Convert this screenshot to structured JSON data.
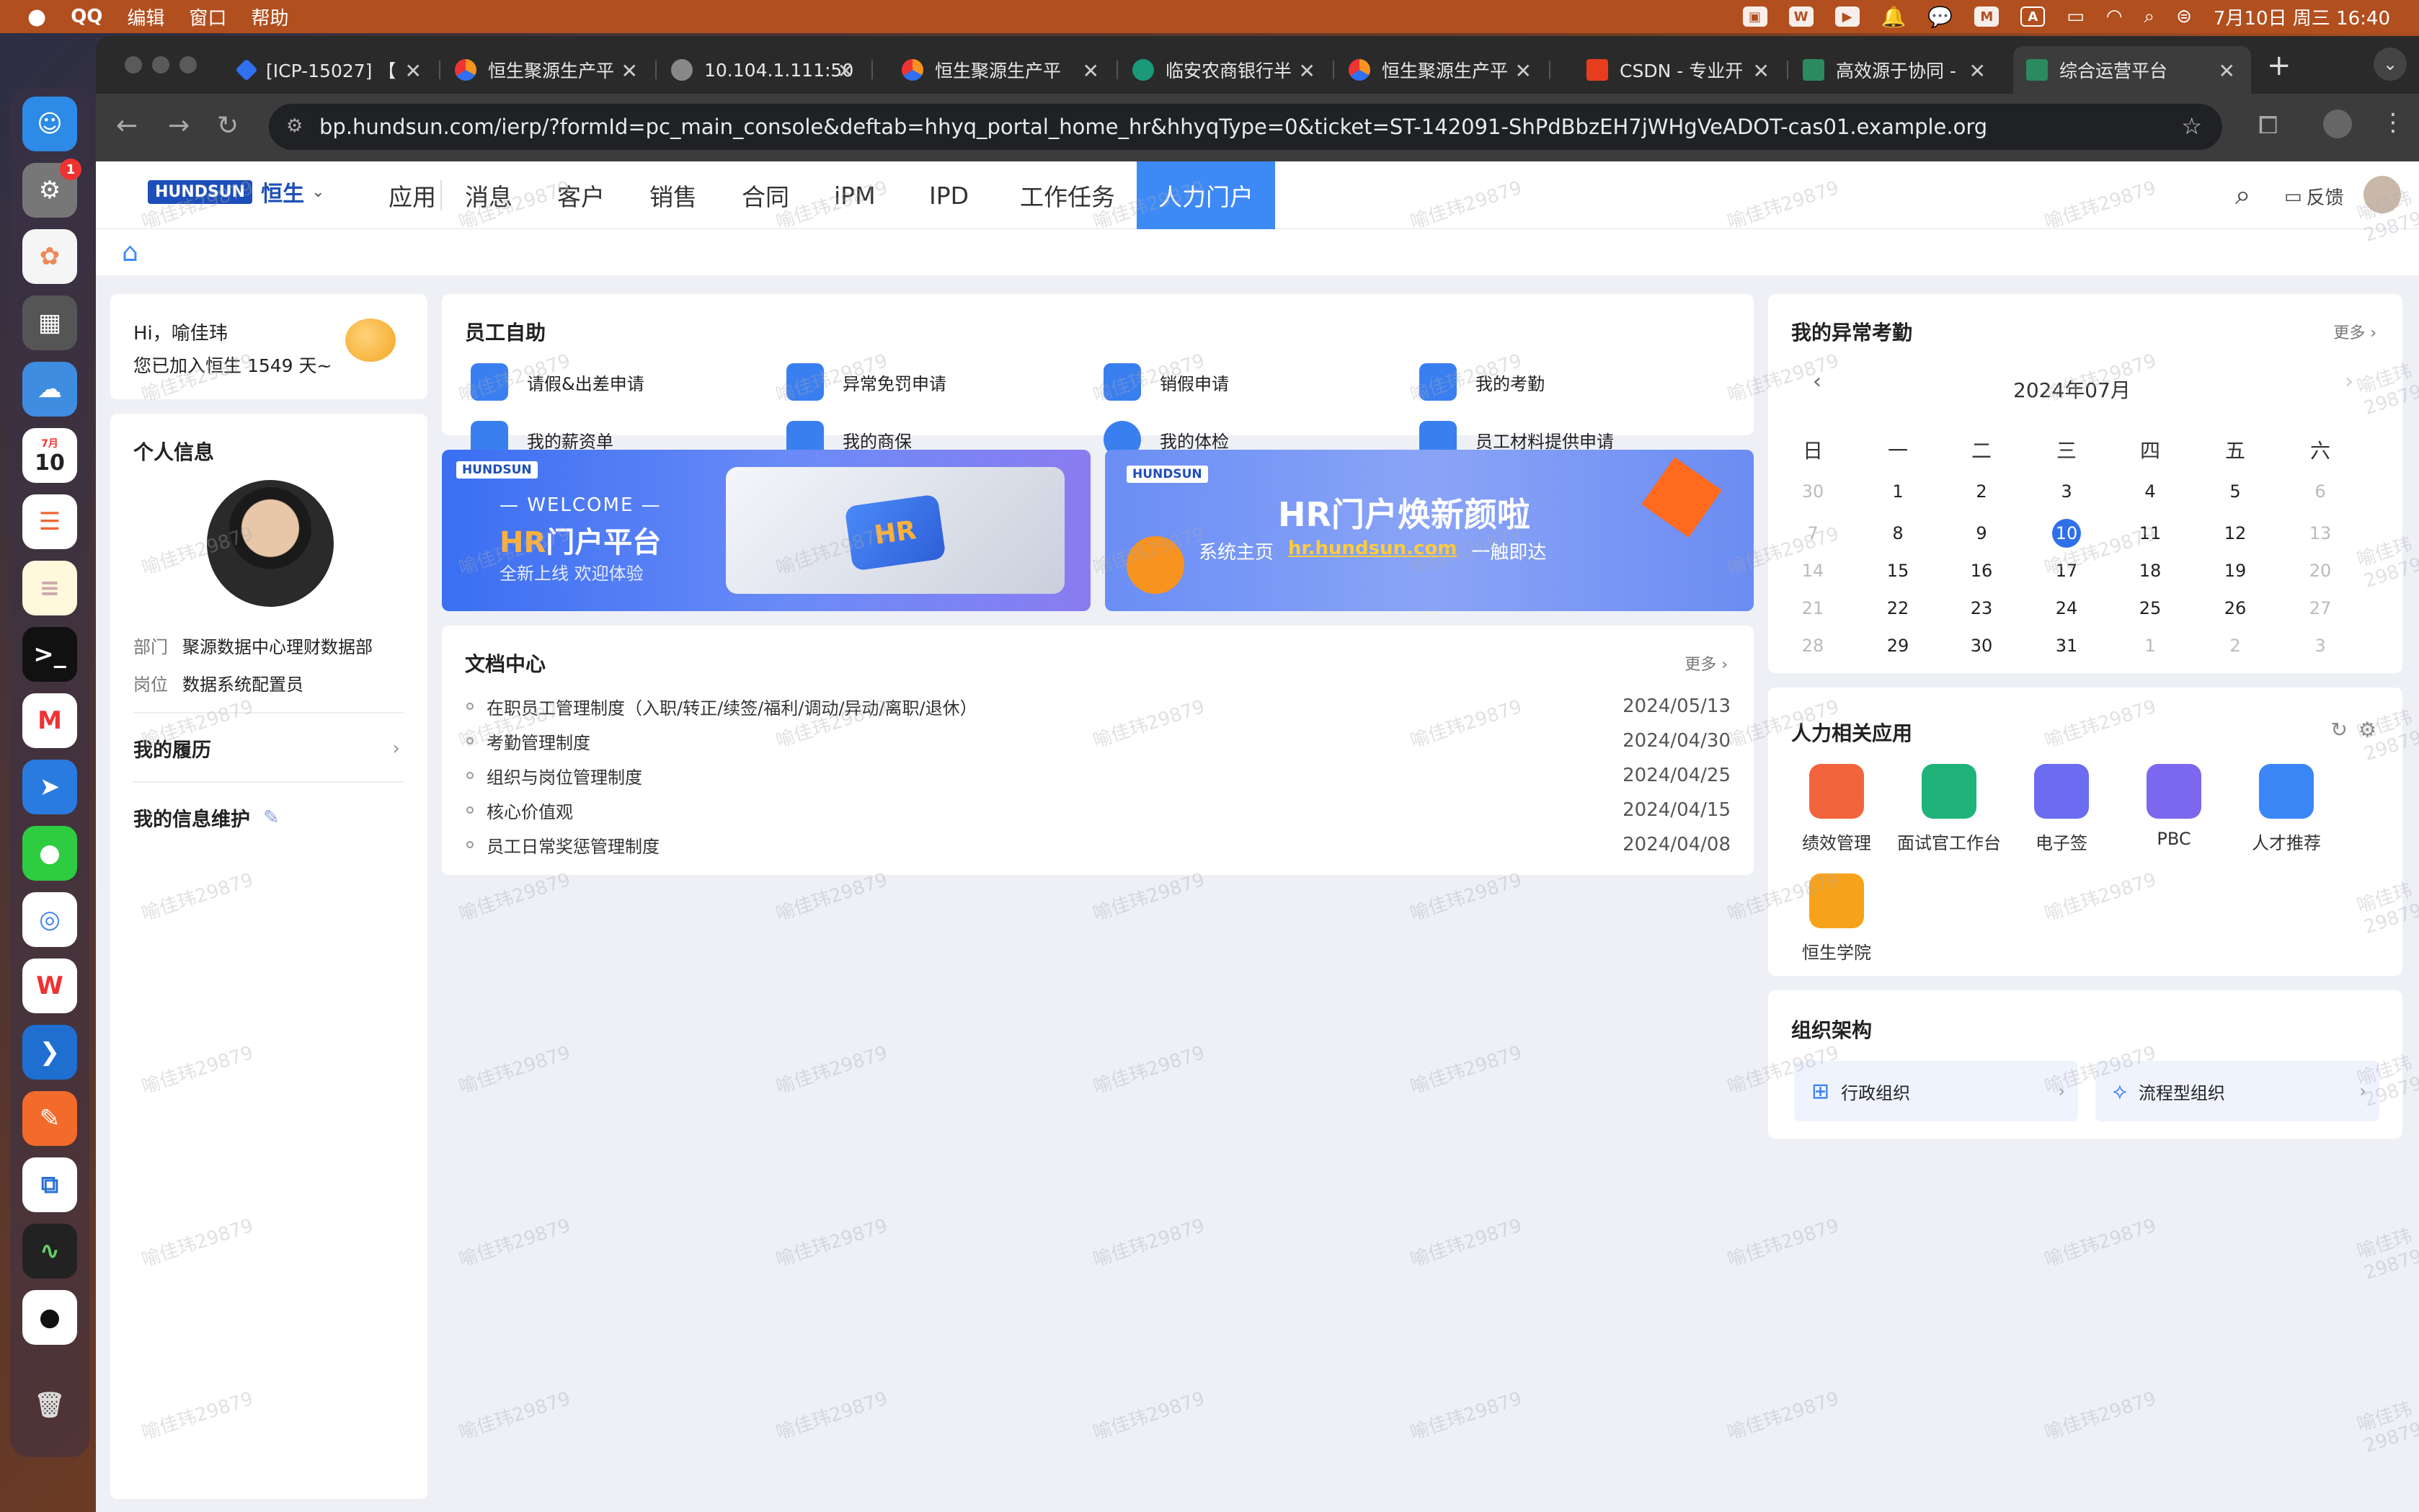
{
  "menubar": {
    "app": "QQ",
    "items": [
      "编辑",
      "窗口",
      "帮助"
    ],
    "clock": "7月10日 周三  16:40",
    "input_method": "A"
  },
  "dock": {
    "badge_count": "1",
    "calendar_month": "7月",
    "calendar_day": "10"
  },
  "tabs": [
    {
      "label": "[ICP-15027] 【"
    },
    {
      "label": "恒生聚源生产平"
    },
    {
      "label": "10.104.1.111:50"
    },
    {
      "label": "恒生聚源生产平"
    },
    {
      "label": "临安农商银行半"
    },
    {
      "label": "恒生聚源生产平"
    },
    {
      "label": "CSDN - 专业开"
    },
    {
      "label": "高效源于协同 -"
    },
    {
      "label": "综合运营平台"
    }
  ],
  "address": {
    "url": "bp.hundsun.com/ierp/?formId=pc_main_console&deftab=hhyq_portal_home_hr&hhyqType=0&ticket=ST-142091-ShPdBbzEH7jWHgVeADOT-cas01.example.org"
  },
  "topnav": {
    "logo_en": "HUNDSUN",
    "logo_cn": "恒生",
    "items": [
      "应用",
      "消息",
      "客户",
      "销售",
      "合同",
      "iPM",
      "IPD",
      "工作任务",
      "人力门户"
    ],
    "feedback": "反馈"
  },
  "greeting": {
    "hi": "Hi，喻佳玮",
    "joined_prefix": "您已加入恒生 ",
    "days": "1549",
    "joined_suffix": " 天~"
  },
  "profile": {
    "title": "个人信息",
    "dept_label": "部门",
    "dept_value": "聚源数据中心理财数据部",
    "post_label": "岗位",
    "post_value": "数据系统配置员",
    "resume": "我的履历",
    "maintain": "我的信息维护"
  },
  "self_service": {
    "title": "员工自助",
    "items": [
      "请假&出差申请",
      "异常免罚申请",
      "销假申请",
      "我的考勤",
      "我的薪资单",
      "我的商保",
      "我的体检",
      "员工材料提供申请"
    ]
  },
  "banner1": {
    "brand": "HUNDSUN",
    "welcome": "— WELCOME —",
    "title_hr": "HR",
    "title_rest": "门户平台",
    "subtitle": "全新上线 欢迎体验",
    "badge": "HR"
  },
  "banner2": {
    "brand": "HUNDSUN",
    "title": "HR门户焕新颜啦",
    "line_prefix": "系统主页",
    "link": "hr.hundsun.com",
    "line_suffix": "一触即达"
  },
  "docs": {
    "title": "文档中心",
    "more": "更多",
    "rows": [
      {
        "name": "在职员工管理制度（入职/转正/续签/福利/调动/异动/离职/退休）",
        "date": "2024/05/13"
      },
      {
        "name": "考勤管理制度",
        "date": "2024/04/30"
      },
      {
        "name": "组织与岗位管理制度",
        "date": "2024/04/25"
      },
      {
        "name": "核心价值观",
        "date": "2024/04/15"
      },
      {
        "name": "员工日常奖惩管理制度",
        "date": "2024/04/08"
      }
    ]
  },
  "attendance": {
    "title": "我的异常考勤",
    "more": "更多",
    "month": "2024年07月",
    "weekdays": [
      "日",
      "一",
      "二",
      "三",
      "四",
      "五",
      "六"
    ],
    "weeks": [
      [
        "30",
        "1",
        "2",
        "3",
        "4",
        "5",
        "6"
      ],
      [
        "7",
        "8",
        "9",
        "10",
        "11",
        "12",
        "13"
      ],
      [
        "14",
        "15",
        "16",
        "17",
        "18",
        "19",
        "20"
      ],
      [
        "21",
        "22",
        "23",
        "24",
        "25",
        "26",
        "27"
      ],
      [
        "28",
        "29",
        "30",
        "31",
        "1",
        "2",
        "3"
      ]
    ],
    "today": "10"
  },
  "hr_apps": {
    "title": "人力相关应用",
    "items": [
      {
        "label": "绩效管理",
        "color": "#f2643c"
      },
      {
        "label": "面试官工作台",
        "color": "#1fb37a"
      },
      {
        "label": "电子签",
        "color": "#6b6cf0"
      },
      {
        "label": "PBC",
        "color": "#7b68ee"
      },
      {
        "label": "人才推荐",
        "color": "#3a86f6"
      },
      {
        "label": "恒生学院",
        "color": "#f7a21b"
      }
    ]
  },
  "org": {
    "title": "组织架构",
    "admin": "行政组织",
    "process": "流程型组织"
  },
  "watermark": "喻佳玮29879",
  "colors": {
    "accent": "#3d8af7",
    "today": "#2f6fe8",
    "menubar": "#b24f1f"
  }
}
